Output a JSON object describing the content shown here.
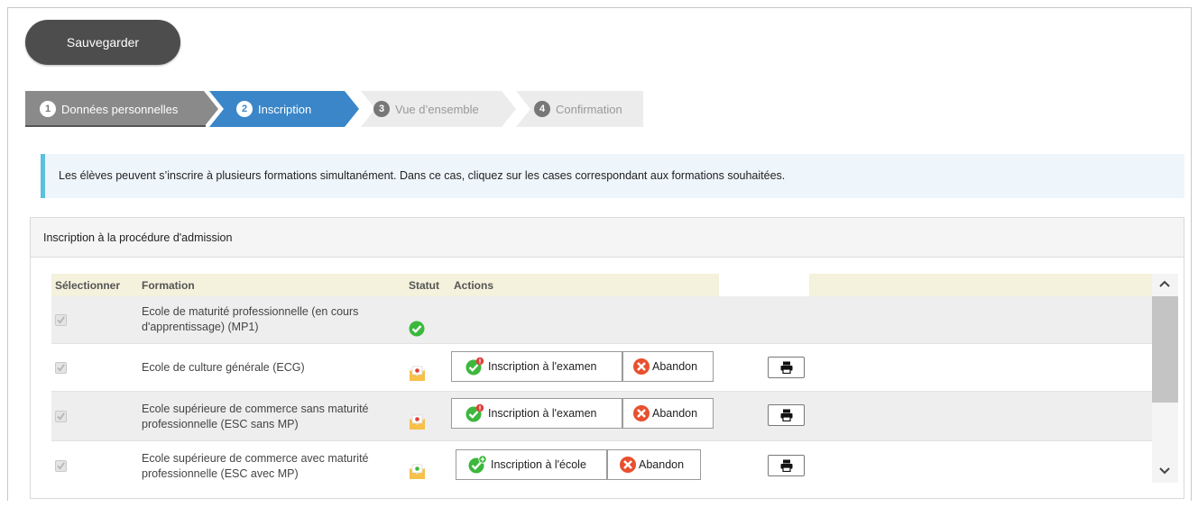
{
  "toolbar": {
    "save_label": "Sauvegarder"
  },
  "steps": [
    {
      "num": "1",
      "label": "Données personnelles",
      "state": "done"
    },
    {
      "num": "2",
      "label": "Inscription",
      "state": "active"
    },
    {
      "num": "3",
      "label": "Vue d’ensemble",
      "state": "pending"
    },
    {
      "num": "4",
      "label": "Confirmation",
      "state": "pending"
    }
  ],
  "info": {
    "text": "Les élèves peuvent s’inscrire à plusieurs formations simultanément. Dans ce cas, cliquez sur les cases correspondant aux formations souhaitées."
  },
  "panel": {
    "title": "Inscription à la procédure d'admission"
  },
  "table": {
    "headers": {
      "select": "Sélectionner",
      "formation": "Formation",
      "status": "Statut",
      "actions": "Actions"
    },
    "rows": [
      {
        "formation_1": "Ecole de maturité professionnelle (en cours",
        "formation_2": "d'apprentissage) (MP1)",
        "status_icon": "check-circle-icon",
        "checked": true
      },
      {
        "formation_1": "Ecole de culture générale (ECG)",
        "formation_2": "",
        "status_icon": "envelope-pending-icon",
        "checked": true,
        "action_primary": "Inscription à l'examen",
        "action_abandon": "Abandon"
      },
      {
        "formation_1": "Ecole supérieure de commerce sans maturité",
        "formation_2": "professionnelle (ESC sans MP)",
        "status_icon": "envelope-pending-icon",
        "checked": true,
        "action_primary": "Inscription à l'examen",
        "action_abandon": "Abandon"
      },
      {
        "formation_1": "Ecole supérieure de commerce avec maturité",
        "formation_2": "professionnelle (ESC avec MP)",
        "status_icon": "envelope-ok-icon",
        "checked": true,
        "action_primary": "Inscription à l'école",
        "action_abandon": "Abandon"
      }
    ]
  },
  "colors": {
    "active_step": "#3a86c8",
    "done_step": "#8a8a8a",
    "pending_step": "#ececec",
    "info_border": "#5bc0de",
    "header_bg": "#f4f1dc"
  }
}
